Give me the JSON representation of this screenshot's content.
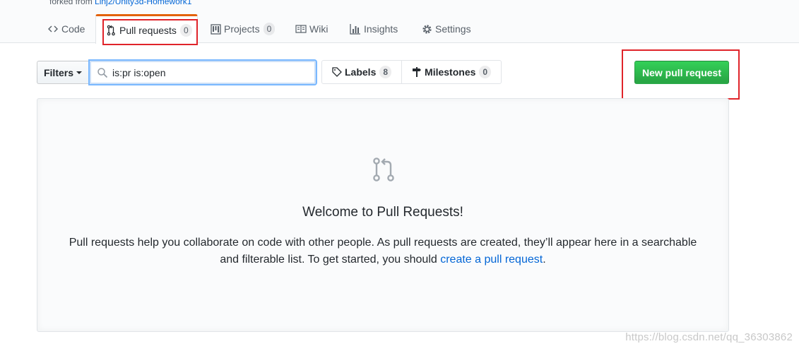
{
  "repo": {
    "forked_prefix": "forked from",
    "forked_link": "Linj2/Unity3d-Homework1"
  },
  "tabs": [
    {
      "label": "Code",
      "icon": "code-icon"
    },
    {
      "label": "Pull requests",
      "icon": "git-pull-request-icon",
      "count": "0",
      "selected": true
    },
    {
      "label": "Projects",
      "icon": "project-icon",
      "count": "0"
    },
    {
      "label": "Wiki",
      "icon": "book-icon"
    },
    {
      "label": "Insights",
      "icon": "graph-icon"
    },
    {
      "label": "Settings",
      "icon": "gear-icon"
    }
  ],
  "toolbar": {
    "filters_label": "Filters",
    "search_value": "is:pr is:open",
    "labels_label": "Labels",
    "labels_count": "8",
    "milestones_label": "Milestones",
    "milestones_count": "0",
    "new_pr_label": "New pull request"
  },
  "blankslate": {
    "title": "Welcome to Pull Requests!",
    "text_line1": "Pull requests help you collaborate on code with other people. As pull requests are created, they’ll appear here in a searchable",
    "text_line2_prefix": "and filterable list. To get started, you should ",
    "text_link": "create a pull request",
    "text_suffix": "."
  },
  "watermark": "https://blog.csdn.net/qq_36303862",
  "colors": {
    "accent_tab": "#e36209",
    "primary_button": "#28a745",
    "link": "#0366d6",
    "highlight_box": "#e0242a"
  }
}
